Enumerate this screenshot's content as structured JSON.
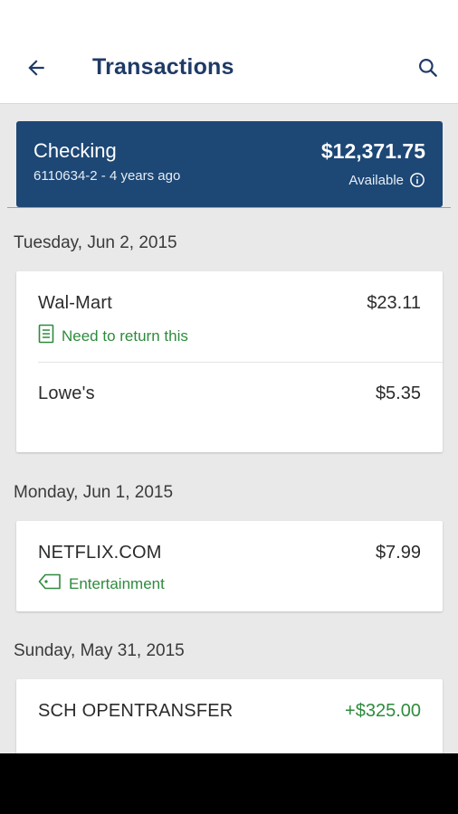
{
  "header": {
    "title": "Transactions",
    "back_icon": "arrow-back-icon",
    "search_icon": "search-icon"
  },
  "account": {
    "name": "Checking",
    "number_age": "6110634-2 - 4 years ago",
    "balance": "$12,371.75",
    "available_label": "Available",
    "info_icon": "info-icon"
  },
  "colors": {
    "brand": "#1f3a66",
    "account_card": "#1d4775",
    "positive": "#2e8b3d",
    "tag_green": "#2e8b3d"
  },
  "groups": [
    {
      "date": "Tuesday, Jun 2, 2015",
      "transactions": [
        {
          "merchant": "Wal-Mart",
          "amount": "$23.11",
          "note": "Need to return this",
          "note_icon": "document-icon"
        },
        {
          "merchant": "Lowe's",
          "amount": "$5.35"
        }
      ]
    },
    {
      "date": "Monday, Jun 1, 2015",
      "transactions": [
        {
          "merchant": "NETFLIX.COM",
          "amount": "$7.99",
          "tag": "Entertainment",
          "tag_icon": "tag-icon"
        }
      ]
    },
    {
      "date": "Sunday, May 31, 2015",
      "transactions": [
        {
          "merchant": "SCH OPENTRANSFER",
          "amount": "+$325.00"
        }
      ]
    }
  ]
}
